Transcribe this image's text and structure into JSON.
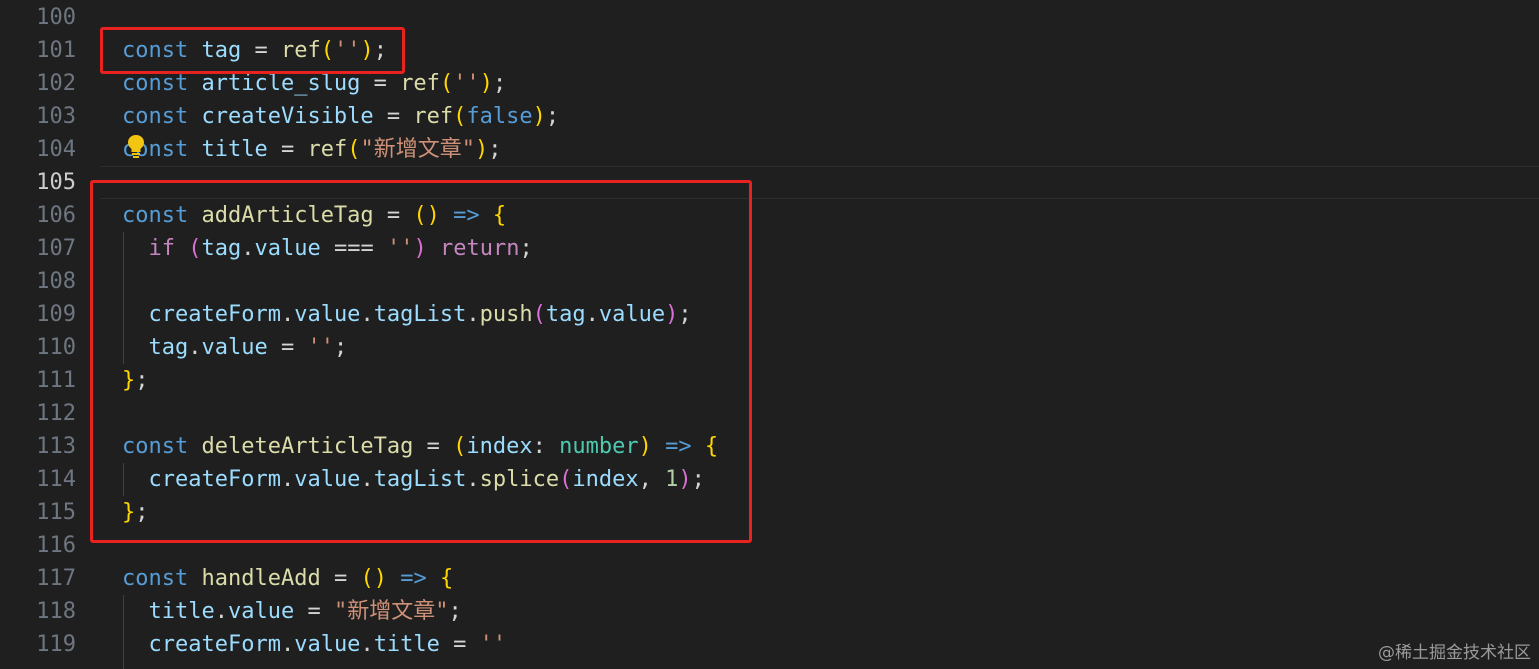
{
  "editor": {
    "lines": [
      {
        "number": "100",
        "tokens": []
      },
      {
        "number": "101",
        "tokens": [
          {
            "t": "const",
            "c": "kw"
          },
          {
            "t": " "
          },
          {
            "t": "tag",
            "c": "var"
          },
          {
            "t": " = "
          },
          {
            "t": "ref",
            "c": "fn"
          },
          {
            "t": "(",
            "c": "p1"
          },
          {
            "t": "''",
            "c": "str"
          },
          {
            "t": ")",
            "c": "p1"
          },
          {
            "t": ";"
          }
        ]
      },
      {
        "number": "102",
        "tokens": [
          {
            "t": "const",
            "c": "kw"
          },
          {
            "t": " "
          },
          {
            "t": "article_slug",
            "c": "var"
          },
          {
            "t": " = "
          },
          {
            "t": "ref",
            "c": "fn"
          },
          {
            "t": "(",
            "c": "p1"
          },
          {
            "t": "''",
            "c": "str"
          },
          {
            "t": ")",
            "c": "p1"
          },
          {
            "t": ";"
          }
        ]
      },
      {
        "number": "103",
        "tokens": [
          {
            "t": "const",
            "c": "kw"
          },
          {
            "t": " "
          },
          {
            "t": "createVisible",
            "c": "var"
          },
          {
            "t": " = "
          },
          {
            "t": "ref",
            "c": "fn"
          },
          {
            "t": "(",
            "c": "p1"
          },
          {
            "t": "false",
            "c": "kw"
          },
          {
            "t": ")",
            "c": "p1"
          },
          {
            "t": ";"
          }
        ]
      },
      {
        "number": "104",
        "tokens": [
          {
            "t": "const",
            "c": "kw"
          },
          {
            "t": " "
          },
          {
            "t": "title",
            "c": "var"
          },
          {
            "t": " = "
          },
          {
            "t": "ref",
            "c": "fn"
          },
          {
            "t": "(",
            "c": "p1"
          },
          {
            "t": "\"新增文章\"",
            "c": "str"
          },
          {
            "t": ")",
            "c": "p1"
          },
          {
            "t": ";"
          }
        ]
      },
      {
        "number": "105",
        "current": true,
        "tokens": []
      },
      {
        "number": "106",
        "tokens": [
          {
            "t": "const",
            "c": "kw"
          },
          {
            "t": " "
          },
          {
            "t": "addArticleTag",
            "c": "fn"
          },
          {
            "t": " = "
          },
          {
            "t": "()",
            "c": "p1"
          },
          {
            "t": " "
          },
          {
            "t": "=>",
            "c": "kw"
          },
          {
            "t": " "
          },
          {
            "t": "{",
            "c": "p1"
          }
        ]
      },
      {
        "number": "107",
        "tokens": [
          {
            "t": "  "
          },
          {
            "t": "if",
            "c": "ctl"
          },
          {
            "t": " "
          },
          {
            "t": "(",
            "c": "p2"
          },
          {
            "t": "tag",
            "c": "var"
          },
          {
            "t": "."
          },
          {
            "t": "value",
            "c": "var"
          },
          {
            "t": " === "
          },
          {
            "t": "''",
            "c": "str"
          },
          {
            "t": ")",
            "c": "p2"
          },
          {
            "t": " "
          },
          {
            "t": "return",
            "c": "ctl"
          },
          {
            "t": ";"
          }
        ]
      },
      {
        "number": "108",
        "tokens": []
      },
      {
        "number": "109",
        "tokens": [
          {
            "t": "  "
          },
          {
            "t": "createForm",
            "c": "var"
          },
          {
            "t": "."
          },
          {
            "t": "value",
            "c": "var"
          },
          {
            "t": "."
          },
          {
            "t": "tagList",
            "c": "var"
          },
          {
            "t": "."
          },
          {
            "t": "push",
            "c": "fn"
          },
          {
            "t": "(",
            "c": "p2"
          },
          {
            "t": "tag",
            "c": "var"
          },
          {
            "t": "."
          },
          {
            "t": "value",
            "c": "var"
          },
          {
            "t": ")",
            "c": "p2"
          },
          {
            "t": ";"
          }
        ]
      },
      {
        "number": "110",
        "tokens": [
          {
            "t": "  "
          },
          {
            "t": "tag",
            "c": "var"
          },
          {
            "t": "."
          },
          {
            "t": "value",
            "c": "var"
          },
          {
            "t": " = "
          },
          {
            "t": "''",
            "c": "str"
          },
          {
            "t": ";"
          }
        ]
      },
      {
        "number": "111",
        "tokens": [
          {
            "t": "}",
            "c": "p1"
          },
          {
            "t": ";"
          }
        ]
      },
      {
        "number": "112",
        "tokens": []
      },
      {
        "number": "113",
        "tokens": [
          {
            "t": "const",
            "c": "kw"
          },
          {
            "t": " "
          },
          {
            "t": "deleteArticleTag",
            "c": "fn"
          },
          {
            "t": " = "
          },
          {
            "t": "(",
            "c": "p1"
          },
          {
            "t": "index",
            "c": "var"
          },
          {
            "t": ": "
          },
          {
            "t": "number",
            "c": "ty"
          },
          {
            "t": ")",
            "c": "p1"
          },
          {
            "t": " "
          },
          {
            "t": "=>",
            "c": "kw"
          },
          {
            "t": " "
          },
          {
            "t": "{",
            "c": "p1"
          }
        ]
      },
      {
        "number": "114",
        "tokens": [
          {
            "t": "  "
          },
          {
            "t": "createForm",
            "c": "var"
          },
          {
            "t": "."
          },
          {
            "t": "value",
            "c": "var"
          },
          {
            "t": "."
          },
          {
            "t": "tagList",
            "c": "var"
          },
          {
            "t": "."
          },
          {
            "t": "splice",
            "c": "fn"
          },
          {
            "t": "(",
            "c": "p2"
          },
          {
            "t": "index",
            "c": "var"
          },
          {
            "t": ", "
          },
          {
            "t": "1",
            "c": "num"
          },
          {
            "t": ")",
            "c": "p2"
          },
          {
            "t": ";"
          }
        ]
      },
      {
        "number": "115",
        "tokens": [
          {
            "t": "}",
            "c": "p1"
          },
          {
            "t": ";"
          }
        ]
      },
      {
        "number": "116",
        "tokens": []
      },
      {
        "number": "117",
        "tokens": [
          {
            "t": "const",
            "c": "kw"
          },
          {
            "t": " "
          },
          {
            "t": "handleAdd",
            "c": "fn"
          },
          {
            "t": " = "
          },
          {
            "t": "()",
            "c": "p1"
          },
          {
            "t": " "
          },
          {
            "t": "=>",
            "c": "kw"
          },
          {
            "t": " "
          },
          {
            "t": "{",
            "c": "p1"
          }
        ]
      },
      {
        "number": "118",
        "tokens": [
          {
            "t": "  "
          },
          {
            "t": "title",
            "c": "var"
          },
          {
            "t": "."
          },
          {
            "t": "value",
            "c": "var"
          },
          {
            "t": " = "
          },
          {
            "t": "\"新增文章\"",
            "c": "str"
          },
          {
            "t": ";"
          }
        ]
      },
      {
        "number": "119",
        "tokens": [
          {
            "t": "  "
          },
          {
            "t": "createForm",
            "c": "var"
          },
          {
            "t": "."
          },
          {
            "t": "value",
            "c": "var"
          },
          {
            "t": "."
          },
          {
            "t": "title",
            "c": "var"
          },
          {
            "t": " = "
          },
          {
            "t": "''",
            "c": "str"
          }
        ]
      }
    ]
  },
  "icons": {
    "lightbulb": "lightbulb-icon"
  },
  "colors": {
    "highlight_box": "#e8231f",
    "background": "#1f1f1f"
  },
  "watermark": "@稀土掘金技术社区"
}
